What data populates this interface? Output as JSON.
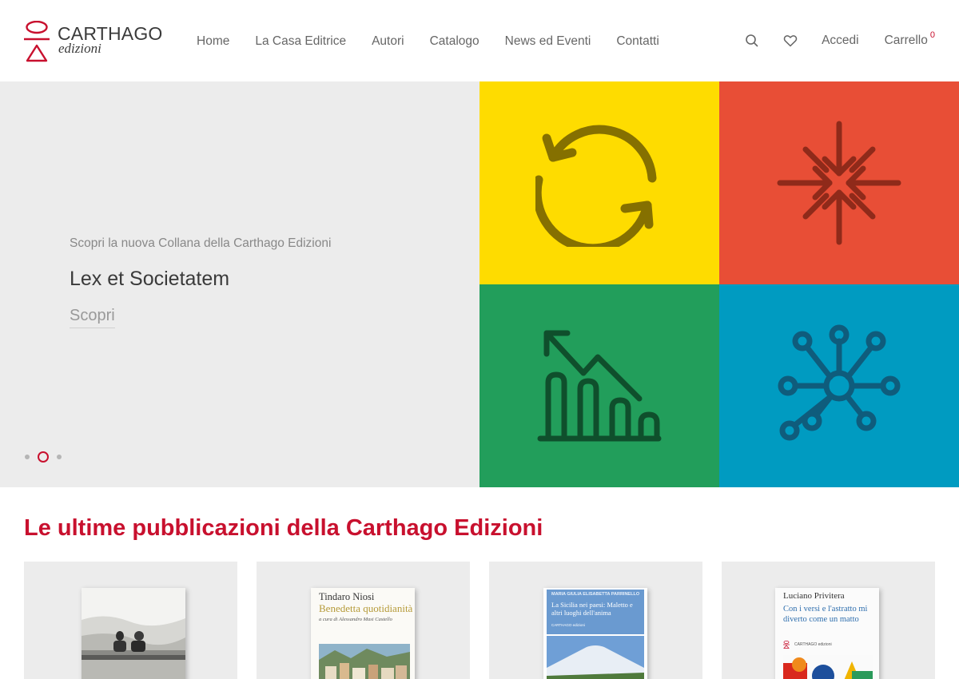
{
  "brand": {
    "name": "CARTHAGO",
    "sub": "edizioni",
    "accent": "#c8102e"
  },
  "nav": [
    "Home",
    "La Casa Editrice",
    "Autori",
    "Catalogo",
    "News ed Eventi",
    "Contatti"
  ],
  "header": {
    "login": "Accedi",
    "cart": "Carrello",
    "cart_count": "0"
  },
  "hero": {
    "kicker": "Scopri la nuova Collana della Carthago Edizioni",
    "title": "Lex et Societatem",
    "cta": "Scopri",
    "dots": 3,
    "active_dot": 2,
    "tile_colors": [
      "#fedc00",
      "#e84e36",
      "#229e5b",
      "#009bc1"
    ]
  },
  "section": {
    "title": "Le ultime pubblicazioni della Carthago Edizioni"
  },
  "books": [
    {
      "author": "",
      "title": "",
      "subtitle": ""
    },
    {
      "author": "Tindaro Niosi",
      "title": "Benedetta quotidianità",
      "subtitle": "a cura di Alessandro Masi Castello"
    },
    {
      "author": "MARIA GIULIA ELISABETTA PARRINELLO",
      "title": "La Sicilia nei paesi: Maletto e altri luoghi dell'anima",
      "publisher": "CARTHAGO edizioni"
    },
    {
      "author": "Luciano Privitera",
      "title": "Con i versi e l'astratto mi diverto come un matto",
      "publisher": "CARTHAGO edizioni"
    }
  ]
}
